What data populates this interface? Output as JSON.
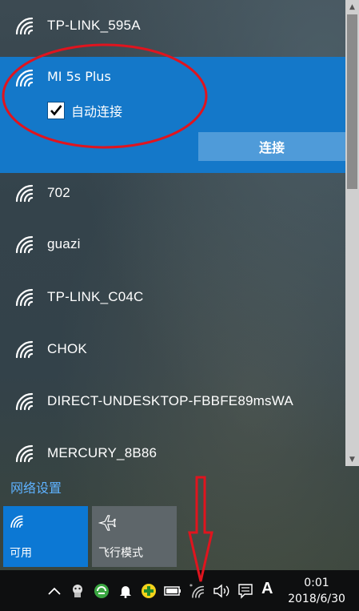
{
  "networks_top": [
    {
      "ssid": "TP-LINK_595A"
    }
  ],
  "selected_network": {
    "ssid": "MI 5s Plus",
    "auto_connect_label": "自动连接",
    "auto_connect_checked": true,
    "connect_label": "连接"
  },
  "networks": [
    {
      "ssid": "702"
    },
    {
      "ssid": "guazi"
    },
    {
      "ssid": "TP-LINK_C04C"
    },
    {
      "ssid": "CHOK"
    },
    {
      "ssid": "DIRECT-UNDESKTOP-FBBFE89msWA"
    },
    {
      "ssid": "MERCURY_8B86"
    }
  ],
  "network_settings_label": "网络设置",
  "quick_tiles": [
    {
      "label": "可用",
      "icon": "wifi-icon",
      "active": true
    },
    {
      "label": "飞行模式",
      "icon": "airplane-icon",
      "active": false
    }
  ],
  "taskbar": {
    "ime_label": "A",
    "time": "0:01",
    "date": "2018/6/30"
  },
  "colors": {
    "accent": "#1478c9",
    "connect_button": "#4f9bd9",
    "link": "#5eb2ff",
    "annotation": "#e0141e"
  }
}
